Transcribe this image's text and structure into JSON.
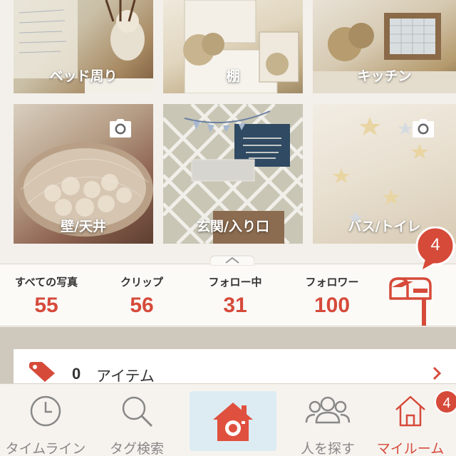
{
  "grid": {
    "tiles": [
      {
        "label": "ベッド周り",
        "has_camera": false
      },
      {
        "label": "棚",
        "has_camera": false
      },
      {
        "label": "キッチン",
        "has_camera": false
      },
      {
        "label": "壁/天井",
        "has_camera": true
      },
      {
        "label": "玄関/入り口",
        "has_camera": false
      },
      {
        "label": "バス/トイレ",
        "has_camera": true
      }
    ],
    "camera_icon": "camera-icon"
  },
  "stats": {
    "all_photos": {
      "label": "すべての写真",
      "value": "55"
    },
    "clips": {
      "label": "クリップ",
      "value": "56"
    },
    "following": {
      "label": "フォロー中",
      "value": "31"
    },
    "followers": {
      "label": "フォロワー",
      "value": "100"
    },
    "mailbox_icon": "mailbox-icon",
    "notification_count": "4"
  },
  "items": {
    "count": "0",
    "label": "アイテム",
    "icon": "tag-icon"
  },
  "tabbar": {
    "timeline": {
      "label": "タイムライン",
      "icon": "clock-icon"
    },
    "tag_search": {
      "label": "タグ検索",
      "icon": "search-icon"
    },
    "post": {
      "icon": "camera-house-icon"
    },
    "find_people": {
      "label": "人を探す",
      "icon": "people-icon"
    },
    "my_room": {
      "label": "マイルーム",
      "icon": "house-icon",
      "badge": "4"
    },
    "active": "my_room"
  },
  "colors": {
    "accent": "#d64a3a",
    "tab_inactive": "#888888",
    "post_button_bg": "#dcecf2"
  }
}
